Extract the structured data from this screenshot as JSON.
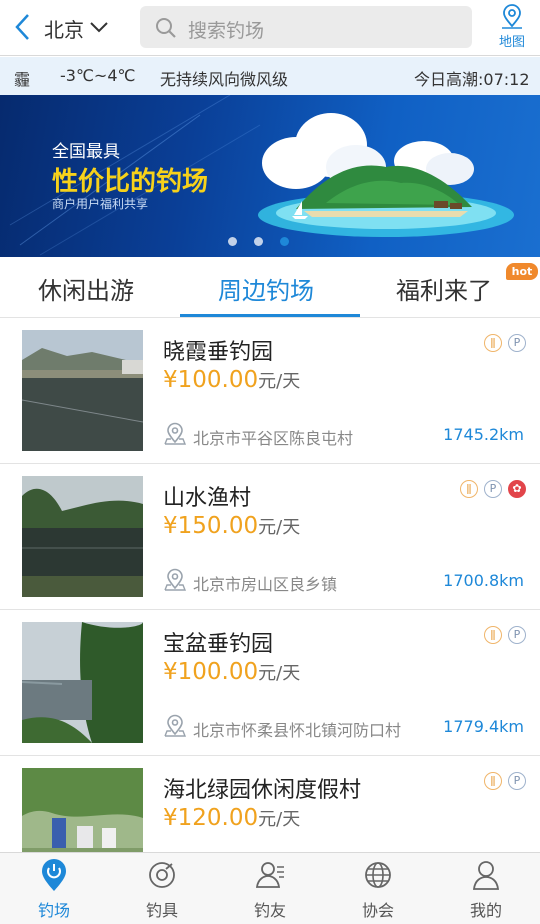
{
  "header": {
    "city": "北京",
    "search_placeholder": "搜索钓场",
    "map_label": "地图"
  },
  "weather": {
    "condition": "霾",
    "temperature": "-3℃~4℃",
    "wind": "无持续风向微风级",
    "tide": "今日高潮:07:12"
  },
  "banner": {
    "line1": "全国最具",
    "line2": "性价比的钓场",
    "line3": "商户用户福利共享",
    "slide_count": 3,
    "active_slide": 3
  },
  "tabs": [
    {
      "label": "休闲出游",
      "active": false
    },
    {
      "label": "周边钓场",
      "active": true
    },
    {
      "label": "福利来了",
      "active": false,
      "badge": "hot"
    }
  ],
  "spots": [
    {
      "name": "晓霞垂钓园",
      "price": "¥100.00",
      "unit": "元/天",
      "address": "北京市平谷区陈良屯村",
      "distance": "1745.2km",
      "tags": [
        "food-icon",
        "parking-icon"
      ]
    },
    {
      "name": "山水渔村",
      "price": "¥150.00",
      "unit": "元/天",
      "address": "北京市房山区良乡镇",
      "distance": "1700.8km",
      "tags": [
        "food-icon",
        "parking-icon",
        "gift-icon"
      ]
    },
    {
      "name": "宝盆垂钓园",
      "price": "¥100.00",
      "unit": "元/天",
      "address": "北京市怀柔县怀北镇河防口村",
      "distance": "1779.4km",
      "tags": [
        "food-icon",
        "parking-icon"
      ]
    },
    {
      "name": "海北绿园休闲度假村",
      "price": "¥120.00",
      "unit": "元/天",
      "address": "",
      "distance": "",
      "tags": [
        "food-icon",
        "parking-icon"
      ]
    }
  ],
  "bottom_nav": [
    {
      "label": "钓场",
      "icon": "location-pin-icon",
      "active": true
    },
    {
      "label": "钓具",
      "icon": "reel-icon",
      "active": false
    },
    {
      "label": "钓友",
      "icon": "friends-icon",
      "active": false
    },
    {
      "label": "协会",
      "icon": "globe-icon",
      "active": false
    },
    {
      "label": "我的",
      "icon": "profile-icon",
      "active": false
    }
  ],
  "colors": {
    "accent": "#1e88d8",
    "price": "#f0a21e",
    "hot_badge": "#f0892c",
    "banner_headline": "#f7d21a"
  }
}
